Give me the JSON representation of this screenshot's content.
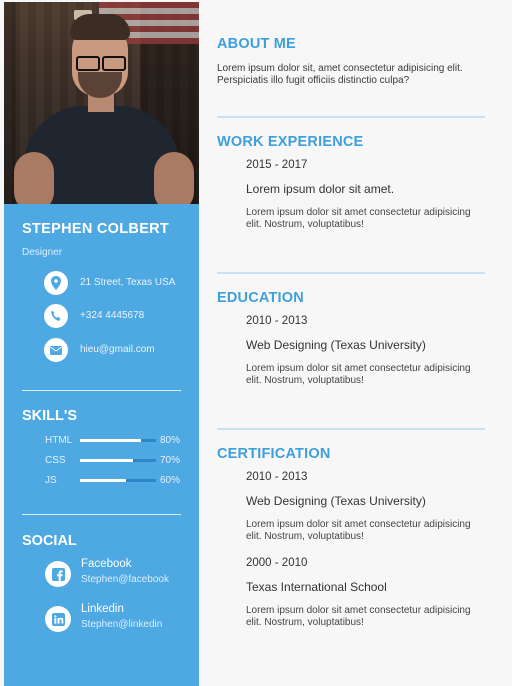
{
  "profile": {
    "name": "STEPHEN COLBERT",
    "role": "Designer"
  },
  "contact": [
    {
      "icon": "location-pin-icon",
      "text": "21 Street, Texas USA"
    },
    {
      "icon": "phone-icon",
      "text": "+324 4445678"
    },
    {
      "icon": "mail-icon",
      "text": "hieu@gmail.com"
    }
  ],
  "skills": {
    "heading": "SKILL'S",
    "items": [
      {
        "label": "HTML",
        "percent_text": "80%",
        "level": 0.8
      },
      {
        "label": "CSS",
        "percent_text": "70%",
        "level": 0.7
      },
      {
        "label": "JS",
        "percent_text": "60%",
        "level": 0.6
      }
    ]
  },
  "social": {
    "heading": "SOCIAL",
    "items": [
      {
        "icon": "facebook-icon",
        "title": "Facebook",
        "handle": "Stephen@facebook"
      },
      {
        "icon": "linkedin-icon",
        "title": "Linkedin",
        "handle": "Stephen@linkedin"
      }
    ]
  },
  "about": {
    "heading": "ABOUT ME",
    "text": "Lorem ipsum dolor sit, amet consectetur adipisicing elit. Perspiciatis illo fugit officiis distinctio culpa?"
  },
  "work": {
    "heading": "WORK EXPERIENCE",
    "entries": [
      {
        "date": "2015 - 2017",
        "title": "Lorem ipsum dolor sit amet.",
        "desc": "Lorem ipsum dolor sit amet consectetur adipisicing elit. Nostrum, voluptatibus!"
      }
    ]
  },
  "education": {
    "heading": "EDUCATION",
    "entries": [
      {
        "date": "2010 - 2013",
        "title": "Web Designing (Texas University)",
        "desc": "Lorem ipsum dolor sit amet consectetur adipisicing elit. Nostrum, voluptatibus!"
      }
    ]
  },
  "certification": {
    "heading": "CERTIFICATION",
    "entries": [
      {
        "date": "2010 - 2013",
        "title": "Web Designing (Texas University)",
        "desc": "Lorem ipsum dolor sit amet consectetur adipisicing elit. Nostrum, voluptatibus!"
      },
      {
        "date": "2000 - 2010",
        "title": "Texas International School",
        "desc": "Lorem ipsum dolor sit amet consectetur adipisicing elit. Nostrum, voluptatibus!"
      }
    ]
  },
  "colors": {
    "sidebar": "#4ea8e2",
    "accent": "#3d9fdc"
  }
}
